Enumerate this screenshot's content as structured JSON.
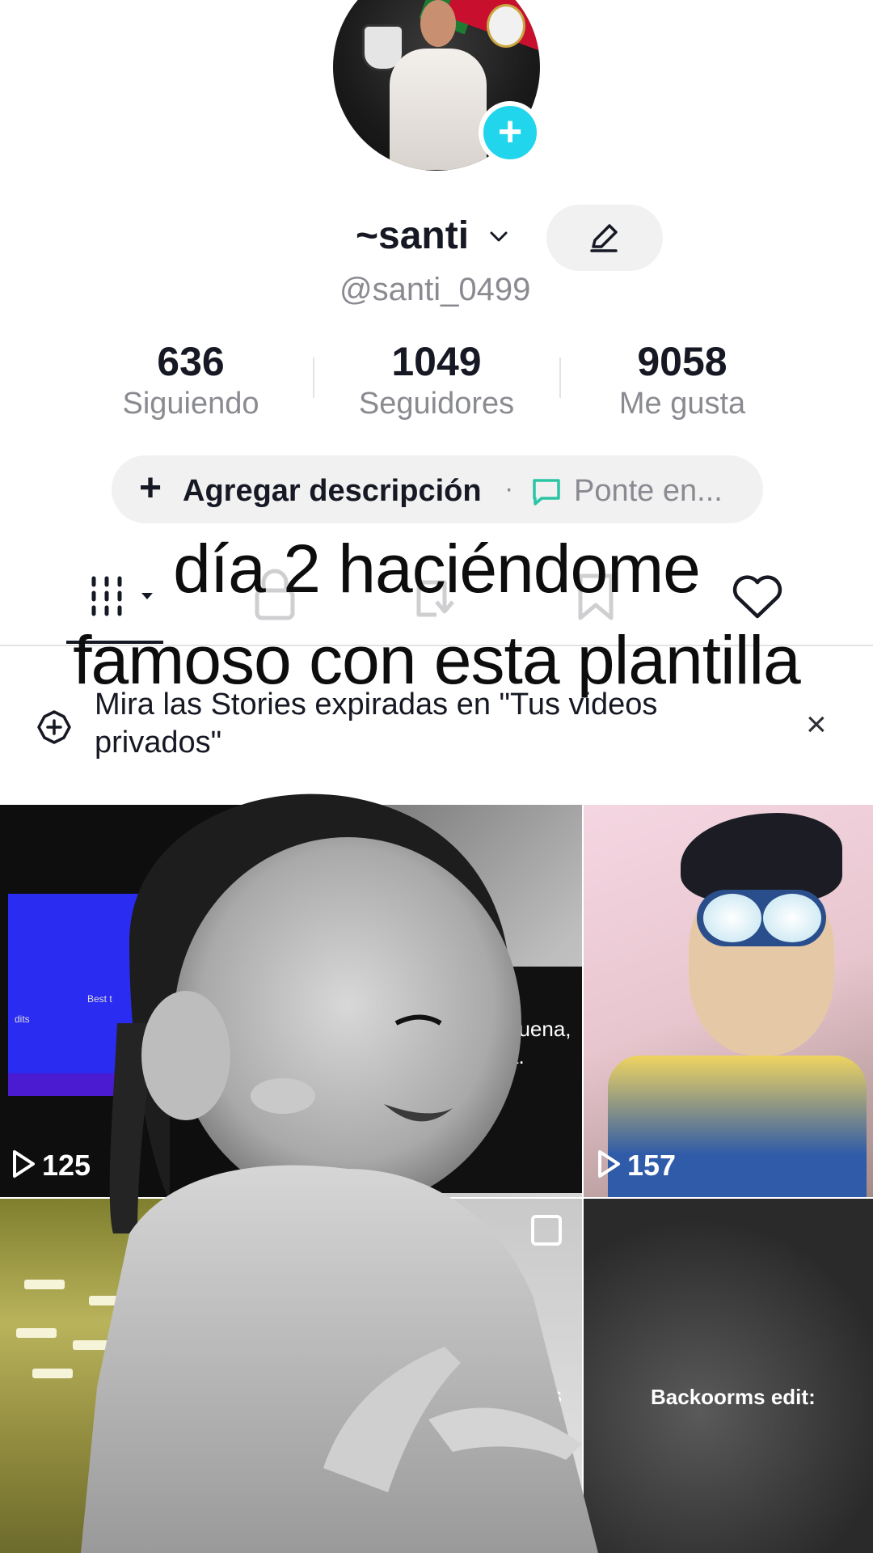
{
  "profile": {
    "display_name": "~santi",
    "username": "@santi_0499"
  },
  "stats": [
    {
      "value": "636",
      "label": "Siguiendo"
    },
    {
      "value": "1049",
      "label": "Seguidores"
    },
    {
      "value": "9058",
      "label": "Me gusta"
    }
  ],
  "bio": {
    "plus": "+",
    "add_label": "Agregar descripción",
    "separator": "·",
    "status_label": "Ponte en..."
  },
  "overlay": {
    "line1": "día 2 haciéndome",
    "line2": "famoso con esta plantilla"
  },
  "tabs": [
    {
      "icon": "grid-icon",
      "active": true
    },
    {
      "icon": "lock-icon"
    },
    {
      "icon": "repost-icon"
    },
    {
      "icon": "bookmark-icon"
    },
    {
      "icon": "heart-icon"
    }
  ],
  "stories_banner": {
    "text": "Mira las Stories expiradas en \"Tus videos privados\"",
    "close": "×"
  },
  "videos": [
    {
      "views": "125",
      "snippet": [
        "Best t",
        "dits"
      ]
    },
    {
      "views": "",
      "snippet": [
        "buena,",
        "a."
      ]
    },
    {
      "views": "157",
      "snippet": []
    },
    {
      "views": "",
      "snippet": []
    },
    {
      "views": "",
      "snippet": [
        "s"
      ]
    },
    {
      "views": "",
      "caption": "Backoorms edit:"
    }
  ],
  "colors": {
    "accent": "#20d5ec",
    "text_primary": "#161823",
    "text_secondary": "#8a8b91",
    "pill_bg": "#f1f1f2"
  }
}
